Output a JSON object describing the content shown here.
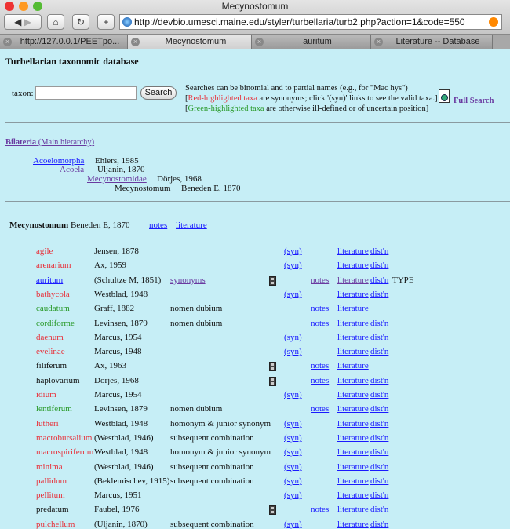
{
  "window": {
    "title": "Mecynostomum",
    "url": "http://devbio.umesci.maine.edu/styler/turbellaria/turb2.php?action=1&code=550"
  },
  "toolbar": {
    "back": "◀",
    "forward": "▶",
    "home": "⌂",
    "reload": "↻",
    "new_tab": "+"
  },
  "tabs": [
    {
      "label": "http://127.0.0.1/PEETpo...",
      "active": false
    },
    {
      "label": "Mecynostomum",
      "active": true
    },
    {
      "label": "auritum",
      "active": false
    },
    {
      "label": "Literature -- Database",
      "active": false
    }
  ],
  "page": {
    "heading": "Turbellarian taxonomic database",
    "search": {
      "label": "taxon:",
      "value": "",
      "placeholder": "",
      "button": "Search",
      "full_search": "Full Search",
      "help1": "Searches can be binomial and to partial names (e.g., for \"Mac hys\")",
      "help2_prefix": "[",
      "help2_red": "Red-highlighted taxa",
      "help2_rest": " are synonyms; click '(syn)' links to see the valid taxa.]",
      "help3_prefix": "[",
      "help3_green": "Green-highlighted taxa",
      "help3_rest": " are otherwise ill-defined or of uncertain position]"
    },
    "hierarchy": {
      "root_bold": "Bilateria",
      "root_rest": " (Main hierarchy)",
      "levels": [
        {
          "name": "Acoelomorpha",
          "author": "Ehlers, 1985"
        },
        {
          "name": "Acoela",
          "author": "Uljanin, 1870"
        },
        {
          "name": "Mecynostomidae",
          "author": "Dörjes, 1968"
        },
        {
          "name": "Mecynostomum",
          "author": "Beneden E, 1870"
        }
      ]
    },
    "genus": {
      "name": "Mecynostomum",
      "author": "Beneden E, 1870",
      "notes": "notes",
      "literature": "literature"
    },
    "species": [
      {
        "name": "agile",
        "color": "red",
        "author": "Jensen, 1878",
        "status": "",
        "film": false,
        "syn": "(syn)",
        "notes": "",
        "lit": "literature",
        "dist": "dist'n",
        "type": ""
      },
      {
        "name": "arenarium",
        "color": "red",
        "author": "Ax, 1959",
        "status": "",
        "film": false,
        "syn": "(syn)",
        "notes": "",
        "lit": "literature",
        "dist": "dist'n",
        "type": ""
      },
      {
        "name": "auritum",
        "color": "link",
        "author": "(Schultze M, 1851)",
        "status": "synonyms",
        "film": true,
        "syn": "",
        "notes": "notes",
        "lit": "literature",
        "dist": "dist'n",
        "type": "TYPE"
      },
      {
        "name": "bathycola",
        "color": "red",
        "author": "Westblad, 1948",
        "status": "",
        "film": false,
        "syn": "(syn)",
        "notes": "",
        "lit": "literature",
        "dist": "dist'n",
        "type": ""
      },
      {
        "name": "caudatum",
        "color": "green",
        "author": "Graff, 1882",
        "status": "nomen dubium",
        "film": false,
        "syn": "",
        "notes": "notes",
        "lit": "literature",
        "dist": "",
        "type": ""
      },
      {
        "name": "cordiforme",
        "color": "green",
        "author": "Levinsen, 1879",
        "status": "nomen dubium",
        "film": false,
        "syn": "",
        "notes": "notes",
        "lit": "literature",
        "dist": "dist'n",
        "type": ""
      },
      {
        "name": "daenum",
        "color": "red",
        "author": "Marcus, 1954",
        "status": "",
        "film": false,
        "syn": "(syn)",
        "notes": "",
        "lit": "literature",
        "dist": "dist'n",
        "type": ""
      },
      {
        "name": "evelinae",
        "color": "red",
        "author": "Marcus, 1948",
        "status": "",
        "film": false,
        "syn": "(syn)",
        "notes": "",
        "lit": "literature",
        "dist": "dist'n",
        "type": ""
      },
      {
        "name": "filiferum",
        "color": "black",
        "author": "Ax, 1963",
        "status": "",
        "film": true,
        "syn": "",
        "notes": "notes",
        "lit": "literature",
        "dist": "",
        "type": ""
      },
      {
        "name": "haplovarium",
        "color": "black",
        "author": "Dörjes, 1968",
        "status": "",
        "film": true,
        "syn": "",
        "notes": "notes",
        "lit": "literature",
        "dist": "dist'n",
        "type": ""
      },
      {
        "name": "idium",
        "color": "red",
        "author": "Marcus, 1954",
        "status": "",
        "film": false,
        "syn": "(syn)",
        "notes": "",
        "lit": "literature",
        "dist": "dist'n",
        "type": ""
      },
      {
        "name": "lentiferum",
        "color": "green",
        "author": "Levinsen, 1879",
        "status": "nomen dubium",
        "film": false,
        "syn": "",
        "notes": "notes",
        "lit": "literature",
        "dist": "dist'n",
        "type": ""
      },
      {
        "name": "lutheri",
        "color": "red",
        "author": "Westblad, 1948",
        "status": "homonym & junior synonym",
        "film": false,
        "syn": "(syn)",
        "notes": "",
        "lit": "literature",
        "dist": "dist'n",
        "type": ""
      },
      {
        "name": "macrobursalium",
        "color": "red",
        "author": "(Westblad, 1946)",
        "status": "subsequent combination",
        "film": false,
        "syn": "(syn)",
        "notes": "",
        "lit": "literature",
        "dist": "dist'n",
        "type": ""
      },
      {
        "name": "macrospiriferum",
        "color": "red",
        "author": "Westblad, 1948",
        "status": "homonym & junior synonym",
        "film": false,
        "syn": "(syn)",
        "notes": "",
        "lit": "literature",
        "dist": "dist'n",
        "type": ""
      },
      {
        "name": "minima",
        "color": "red",
        "author": "(Westblad, 1946)",
        "status": "subsequent combination",
        "film": false,
        "syn": "(syn)",
        "notes": "",
        "lit": "literature",
        "dist": "dist'n",
        "type": ""
      },
      {
        "name": "pallidum",
        "color": "red",
        "author": "(Beklemischev, 1915)",
        "status": "subsequent combination",
        "film": false,
        "syn": "(syn)",
        "notes": "",
        "lit": "literature",
        "dist": "dist'n",
        "type": ""
      },
      {
        "name": "pellitum",
        "color": "red",
        "author": "Marcus, 1951",
        "status": "",
        "film": false,
        "syn": "(syn)",
        "notes": "",
        "lit": "literature",
        "dist": "dist'n",
        "type": ""
      },
      {
        "name": "predatum",
        "color": "black",
        "author": "Faubel, 1976",
        "status": "",
        "film": true,
        "syn": "",
        "notes": "notes",
        "lit": "literature",
        "dist": "dist'n",
        "type": ""
      },
      {
        "name": "pulchellum",
        "color": "red",
        "author": "(Uljanin, 1870)",
        "status": "subsequent combination",
        "film": false,
        "syn": "(syn)",
        "notes": "",
        "lit": "literature",
        "dist": "dist'n",
        "type": ""
      }
    ]
  },
  "colors": {
    "background": "#c6eef6",
    "red": "#e8303a",
    "green": "#2a9a2a",
    "link": "#1a1aff",
    "visited": "#6a3aa0"
  }
}
